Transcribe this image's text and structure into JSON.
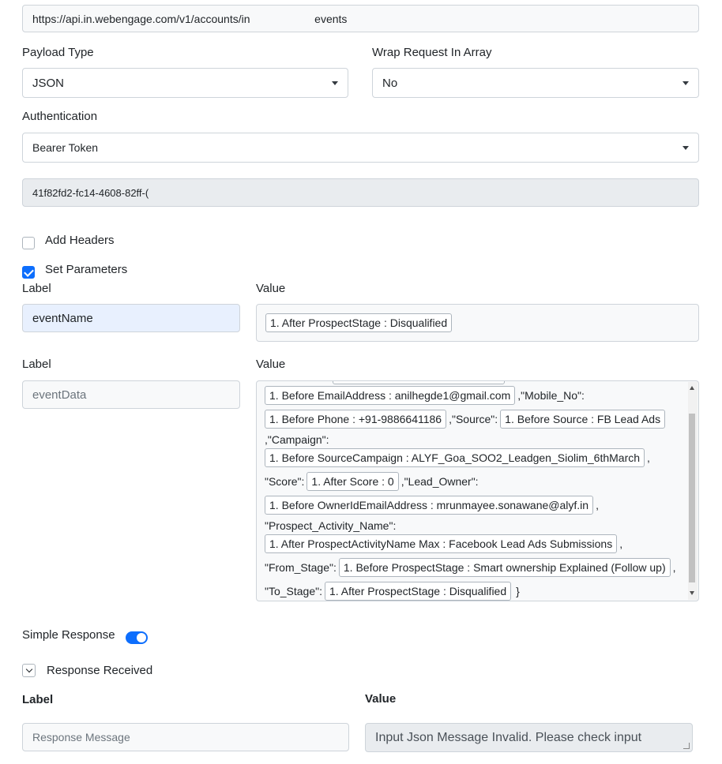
{
  "url_field": {
    "value": "https://api.in.webengage.com/v1/accounts/in                     events"
  },
  "payload_type": {
    "label": "Payload Type",
    "selected": "JSON"
  },
  "wrap_request": {
    "label": "Wrap Request In Array",
    "selected": "No"
  },
  "authentication": {
    "label": "Authentication",
    "selected": "Bearer Token",
    "token": "41f82fd2-fc14-4608-82ff-("
  },
  "add_headers": {
    "label": "Add Headers",
    "checked": false
  },
  "set_parameters": {
    "label": "Set Parameters",
    "checked": true
  },
  "param1": {
    "label_caption": "Label",
    "value_caption": "Value",
    "label_value": "eventName",
    "chip": "1. After ProspectStage : Disqualified"
  },
  "param2": {
    "label_caption": "Label",
    "value_caption": "Value",
    "label_value": "eventData",
    "lines": [
      {
        "chip": "1. Before EmailAddress : anilhegde1@gmail.com",
        "after": ",\"Mobile_No\":"
      },
      {
        "chip": "1. Before Phone : +91-9886641186",
        "mid": ",\"Source\":",
        "chip2": "1. Before Source : FB Lead Ads"
      },
      {
        "text": ",\"Campaign\":"
      },
      {
        "chip": "1. Before SourceCampaign : ALYF_Goa_SOO2_Leadgen_Siolim_6thMarch",
        "after": ","
      },
      {
        "before": "\"Score\":",
        "chip": "1. After Score : 0",
        "after": ",\"Lead_Owner\":"
      },
      {
        "chip": "1. Before OwnerIdEmailAddress : mrunmayee.sonawane@alyf.in",
        "after": ","
      },
      {
        "text": "\"Prospect_Activity_Name\":"
      },
      {
        "chip": "1. After ProspectActivityName Max : Facebook Lead Ads Submissions",
        "after": ","
      },
      {
        "before": "\"From_Stage\":",
        "chip": "1. Before ProspectStage : Smart ownership Explained (Follow up)",
        "after": ","
      },
      {
        "before": "\"To_Stage\":",
        "chip": "1. After ProspectStage : Disqualified",
        "after": "}"
      }
    ]
  },
  "simple_response": {
    "label": "Simple Response",
    "on": true
  },
  "response_received": {
    "label": "Response Received"
  },
  "response": {
    "label_caption": "Label",
    "value_caption": "Value",
    "label_value": "Response Message",
    "value": "Input Json Message Invalid. Please check input"
  },
  "icons": {
    "dropdown": "caret-down-icon",
    "check": "check-icon",
    "chevron": "chevron-down-icon"
  },
  "colors": {
    "accent": "#0d6efd",
    "readonly_bg": "#e9ecef",
    "highlight_bg": "#e8f0fe"
  }
}
